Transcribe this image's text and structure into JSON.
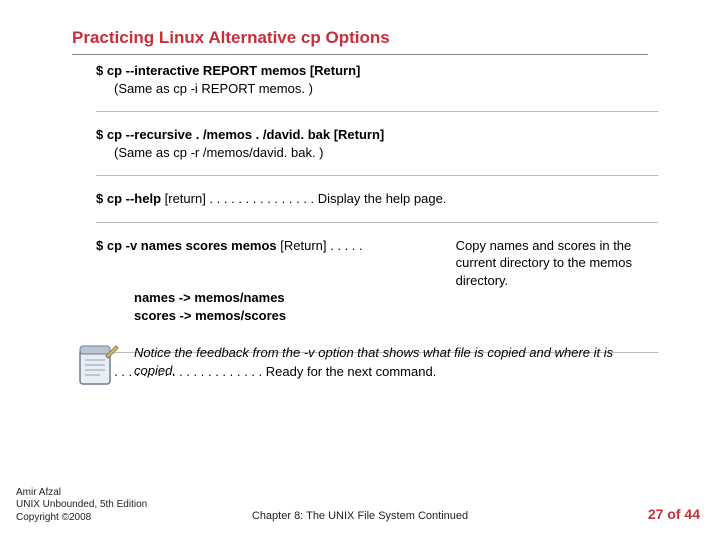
{
  "title": "Practicing Linux Alternative cp Options",
  "blocks": {
    "b1_cmd": "$ cp --interactive REPORT memos [Return]",
    "b1_sub": "(Same as cp -i REPORT memos. )",
    "b2_cmd": "$ cp --recursive . /memos . /david. bak [Return]",
    "b2_sub": "(Same as cp -r /memos/david. bak. )",
    "b3_cmd": "$ cp --help",
    "b3_tail": " [return] . . . . . . . . . . . . . . . Display the help page.",
    "b4_left_bold": "$ cp -v names scores memos",
    "b4_left_tail": " [Return] . . . . .",
    "b4_right": "Copy names and scores in the current directory to the memos directory.",
    "b4_out1": "names -> memos/names",
    "b4_out2": "scores -> memos/scores",
    "b5_prompt": "$_",
    "b5_tail": " . . . . . . . . . . . . . . . . . . . . . Ready for the next command."
  },
  "note": "Notice the feedback from the -v option that shows what file is copied and where it is copied.",
  "footer": {
    "author": "Amir Afzal",
    "book": "UNIX Unbounded, 5th Edition",
    "copyright": "Copyright ©2008",
    "chapter": "Chapter 8: The UNIX File System Continued",
    "page_current": "27",
    "page_sep": " of ",
    "page_total": "44"
  }
}
